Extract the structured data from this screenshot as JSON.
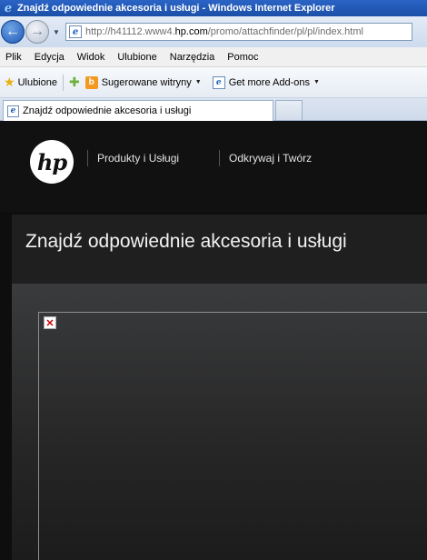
{
  "window": {
    "title": "Znajdź odpowiednie akcesoria i usługi - Windows Internet Explorer"
  },
  "address_bar": {
    "url_prefix": "http://h41112.www4.",
    "url_domain": "hp.com",
    "url_suffix": "/promo/attachfinder/pl/pl/index.html"
  },
  "menu": {
    "items": [
      "Plik",
      "Edycja",
      "Widok",
      "Ulubione",
      "Narzędzia",
      "Pomoc"
    ]
  },
  "favorites_bar": {
    "favorites_label": "Ulubione",
    "suggested_sites": "Sugerowane witryny",
    "get_addons": "Get more Add-ons"
  },
  "tabs": {
    "active_tab_title": "Znajdź odpowiednie akcesoria i usługi"
  },
  "page": {
    "logo_text": "hp",
    "nav": [
      "Produkty i Usługi",
      "Odkrywaj i Twórz"
    ],
    "heading": "Znajdź odpowiednie akcesoria i usługi"
  }
}
